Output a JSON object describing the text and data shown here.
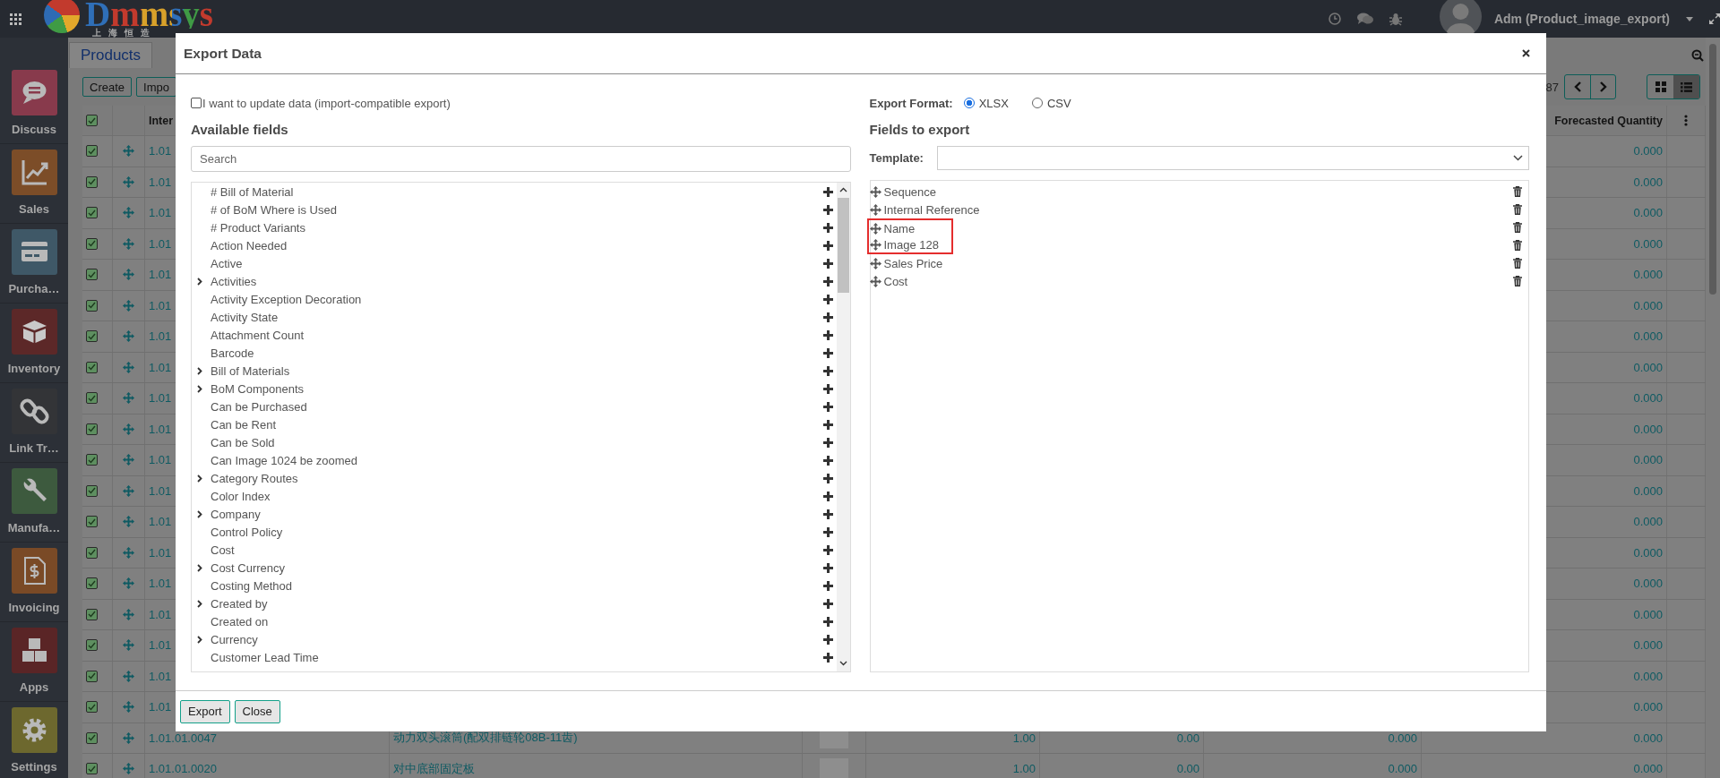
{
  "navbar": {
    "logo": {
      "text": "Dmmsys",
      "subtitle": "上海恒造"
    },
    "user": "Adm (Product_image_export)"
  },
  "sidebar": {
    "items": [
      {
        "label": "Discuss",
        "kind": "chat",
        "color": "#883a4c"
      },
      {
        "label": "Sales",
        "kind": "chart",
        "color": "#7c4d28"
      },
      {
        "label": "Purcha…",
        "kind": "card",
        "color": "#3f5867"
      },
      {
        "label": "Inventory",
        "kind": "box",
        "color": "#5c2828"
      },
      {
        "label": "Link Tr…",
        "kind": "link",
        "color": "#333437"
      },
      {
        "label": "Manufa…",
        "kind": "wrench",
        "color": "#3d5a3e"
      },
      {
        "label": "Invoicing",
        "kind": "invoice",
        "color": "#7a4a26"
      },
      {
        "label": "Apps",
        "kind": "cubes",
        "color": "#5a2526"
      },
      {
        "label": "Settings",
        "kind": "gear",
        "color": "#6d682e"
      }
    ]
  },
  "control_panel": {
    "breadcrumb": "Products",
    "buttons": [
      "Create",
      "Impo"
    ],
    "pager": "87"
  },
  "list": {
    "all_selected": true,
    "header": {
      "reference": "Inter",
      "forecasted": "Forecasted Quantity"
    },
    "rows": [
      {
        "selected": true,
        "reference": "1.01",
        "forecasted": "0.000"
      },
      {
        "selected": true,
        "reference": "1.01",
        "forecasted": "0.000"
      },
      {
        "selected": true,
        "reference": "1.01",
        "forecasted": "0.000"
      },
      {
        "selected": true,
        "reference": "1.01",
        "forecasted": "0.000"
      },
      {
        "selected": true,
        "reference": "1.01",
        "forecasted": "0.000"
      },
      {
        "selected": true,
        "reference": "1.01",
        "forecasted": "0.000"
      },
      {
        "selected": true,
        "reference": "1.01",
        "forecasted": "0.000"
      },
      {
        "selected": true,
        "reference": "1.01",
        "forecasted": "0.000"
      },
      {
        "selected": true,
        "reference": "1.01",
        "forecasted": "0.000"
      },
      {
        "selected": true,
        "reference": "1.01",
        "forecasted": "0.000"
      },
      {
        "selected": true,
        "reference": "1.01",
        "forecasted": "0.000"
      },
      {
        "selected": true,
        "reference": "1.01",
        "forecasted": "0.000"
      },
      {
        "selected": true,
        "reference": "1.01",
        "forecasted": "0.000"
      },
      {
        "selected": true,
        "reference": "1.01",
        "forecasted": "0.000"
      },
      {
        "selected": true,
        "reference": "1.01",
        "forecasted": "0.000"
      },
      {
        "selected": true,
        "reference": "1.01",
        "forecasted": "0.000"
      },
      {
        "selected": true,
        "reference": "1.01",
        "forecasted": "0.000"
      },
      {
        "selected": true,
        "reference": "1.01",
        "forecasted": "0.000"
      },
      {
        "selected": true,
        "reference": "1.01",
        "forecasted": "0.000"
      },
      {
        "selected": true,
        "reference": "1.01.01.0047",
        "column_3": "动力双头滚筒(配双排链轮08B-11齿)",
        "column_5": "1.00",
        "column_6": "0.00",
        "column_7": "0.000",
        "forecasted": "0.000"
      },
      {
        "selected": true,
        "reference": "1.01.01.0020",
        "column_3": "对中底部固定板",
        "column_5": "1.00",
        "column_6": "0.00",
        "column_7": "0.000",
        "forecasted": "0.000"
      }
    ]
  },
  "dialog": {
    "title": "Export Data",
    "import_compatible": {
      "label": "I want to update data (import-compatible export)",
      "checked": false
    },
    "available_heading": "Available fields",
    "search": {
      "placeholder": "Search"
    },
    "available_fields": [
      {
        "label": "# Bill of Material",
        "expandable": false
      },
      {
        "label": "# of BoM Where is Used",
        "expandable": false
      },
      {
        "label": "# Product Variants",
        "expandable": false
      },
      {
        "label": "Action Needed",
        "expandable": false
      },
      {
        "label": "Active",
        "expandable": false
      },
      {
        "label": "Activities",
        "expandable": true
      },
      {
        "label": "Activity Exception Decoration",
        "expandable": false
      },
      {
        "label": "Activity State",
        "expandable": false
      },
      {
        "label": "Attachment Count",
        "expandable": false
      },
      {
        "label": "Barcode",
        "expandable": false
      },
      {
        "label": "Bill of Materials",
        "expandable": true
      },
      {
        "label": "BoM Components",
        "expandable": true
      },
      {
        "label": "Can be Purchased",
        "expandable": false
      },
      {
        "label": "Can be Rent",
        "expandable": false
      },
      {
        "label": "Can be Sold",
        "expandable": false
      },
      {
        "label": "Can Image 1024 be zoomed",
        "expandable": false
      },
      {
        "label": "Category Routes",
        "expandable": true
      },
      {
        "label": "Color Index",
        "expandable": false
      },
      {
        "label": "Company",
        "expandable": true
      },
      {
        "label": "Control Policy",
        "expandable": false
      },
      {
        "label": "Cost",
        "expandable": false
      },
      {
        "label": "Cost Currency",
        "expandable": true
      },
      {
        "label": "Costing Method",
        "expandable": false
      },
      {
        "label": "Created by",
        "expandable": true
      },
      {
        "label": "Created on",
        "expandable": false
      },
      {
        "label": "Currency",
        "expandable": true
      },
      {
        "label": "Customer Lead Time",
        "expandable": false
      }
    ],
    "format_label": "Export Format:",
    "formats": [
      {
        "label": "XLSX",
        "selected": true
      },
      {
        "label": "CSV",
        "selected": false
      }
    ],
    "export_heading": "Fields to export",
    "template_label": "Template:",
    "export_fields": [
      {
        "label": "Sequence",
        "highlighted": false
      },
      {
        "label": "Internal Reference",
        "highlighted": false
      },
      {
        "label": "Name",
        "highlighted": true
      },
      {
        "label": "Image 128",
        "highlighted": true
      },
      {
        "label": "Sales Price",
        "highlighted": false
      },
      {
        "label": "Cost",
        "highlighted": false
      }
    ],
    "buttons": [
      "Export",
      "Close"
    ]
  }
}
